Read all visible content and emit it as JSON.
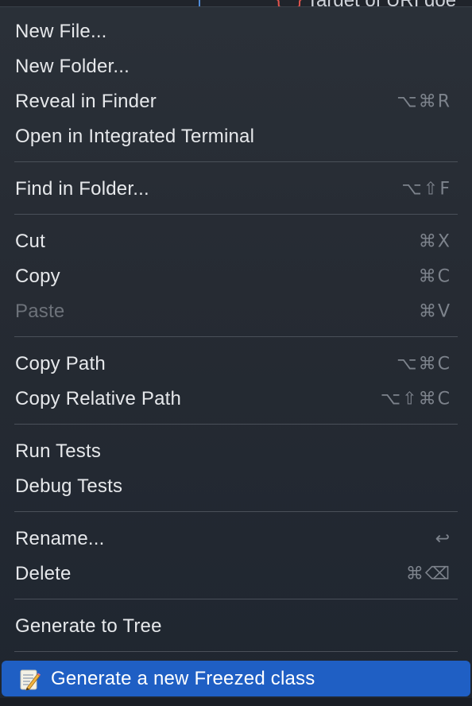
{
  "background_editor": {
    "brace_glyph": "{ }",
    "partial_text": "Target of URI doe"
  },
  "menu": {
    "groups": [
      {
        "items": [
          {
            "label": "New File...",
            "shortcut": ""
          },
          {
            "label": "New Folder...",
            "shortcut": ""
          },
          {
            "label": "Reveal in Finder",
            "shortcut": "⌥⌘R"
          },
          {
            "label": "Open in Integrated Terminal",
            "shortcut": ""
          }
        ]
      },
      {
        "items": [
          {
            "label": "Find in Folder...",
            "shortcut": "⌥⇧F"
          }
        ]
      },
      {
        "items": [
          {
            "label": "Cut",
            "shortcut": "⌘X"
          },
          {
            "label": "Copy",
            "shortcut": "⌘C"
          },
          {
            "label": "Paste",
            "shortcut": "⌘V",
            "disabled": true
          }
        ]
      },
      {
        "items": [
          {
            "label": "Copy Path",
            "shortcut": "⌥⌘C"
          },
          {
            "label": "Copy Relative Path",
            "shortcut": "⌥⇧⌘C"
          }
        ]
      },
      {
        "items": [
          {
            "label": "Run Tests",
            "shortcut": ""
          },
          {
            "label": "Debug Tests",
            "shortcut": ""
          }
        ]
      },
      {
        "items": [
          {
            "label": "Rename...",
            "shortcut": "↩"
          },
          {
            "label": "Delete",
            "shortcut": "⌘⌫"
          }
        ]
      },
      {
        "items": [
          {
            "label": "Generate to Tree",
            "shortcut": ""
          }
        ]
      },
      {
        "items": [
          {
            "label": "Generate a new Freezed class",
            "shortcut": "",
            "icon": "memo-icon",
            "highlighted": true
          }
        ]
      }
    ]
  },
  "colors": {
    "highlight": "#1f5fc4",
    "text": "#e6e8eb",
    "shortcut": "#7d838c",
    "disabled": "#6d727a",
    "separator": "#4a5059"
  }
}
